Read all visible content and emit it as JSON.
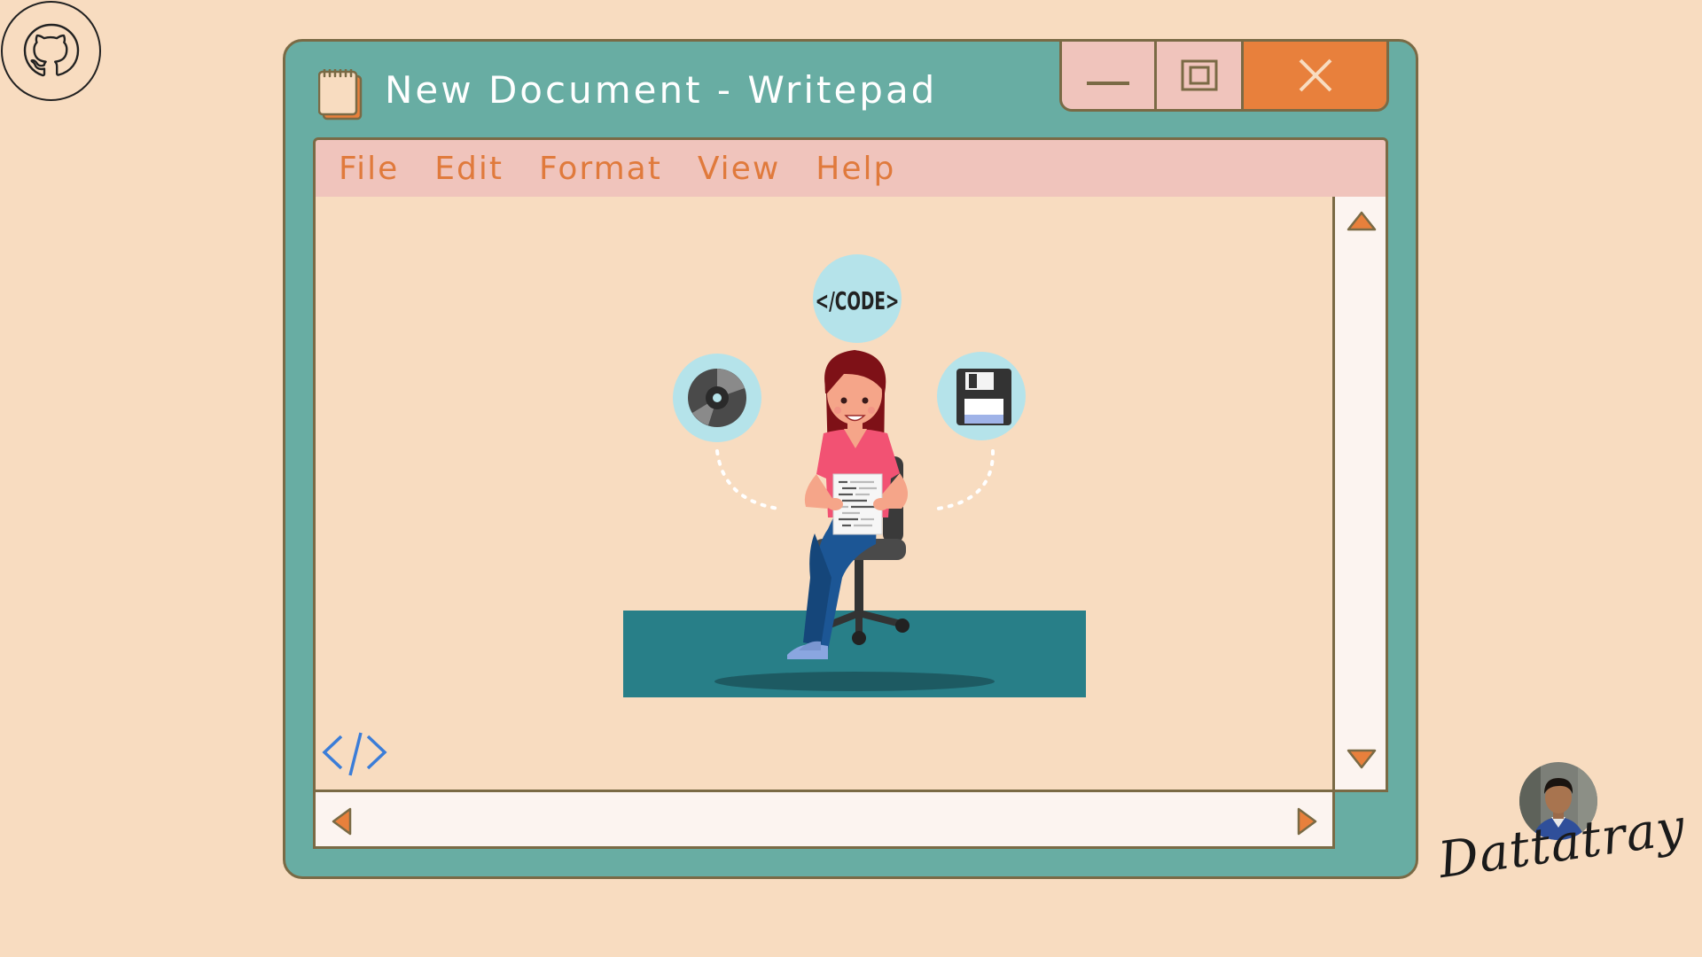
{
  "window": {
    "title": "New Document - Writepad",
    "frame_color": "#68ada3",
    "close_color": "#e8803c"
  },
  "menu": {
    "items": [
      {
        "label": "File"
      },
      {
        "label": "Edit"
      },
      {
        "label": "Format"
      },
      {
        "label": "View"
      },
      {
        "label": "Help"
      }
    ]
  },
  "illustration": {
    "badge_text": "</CODE>"
  },
  "icons": {
    "github": "github-icon",
    "notepad": "notepad-icon",
    "minimize": "minimize-icon",
    "maximize": "maximize-icon",
    "close": "close-icon",
    "disc": "disc-icon",
    "floppy": "floppy-disk-icon",
    "code": "code-tag-icon"
  },
  "footer": {
    "signature": "Dattatray"
  }
}
